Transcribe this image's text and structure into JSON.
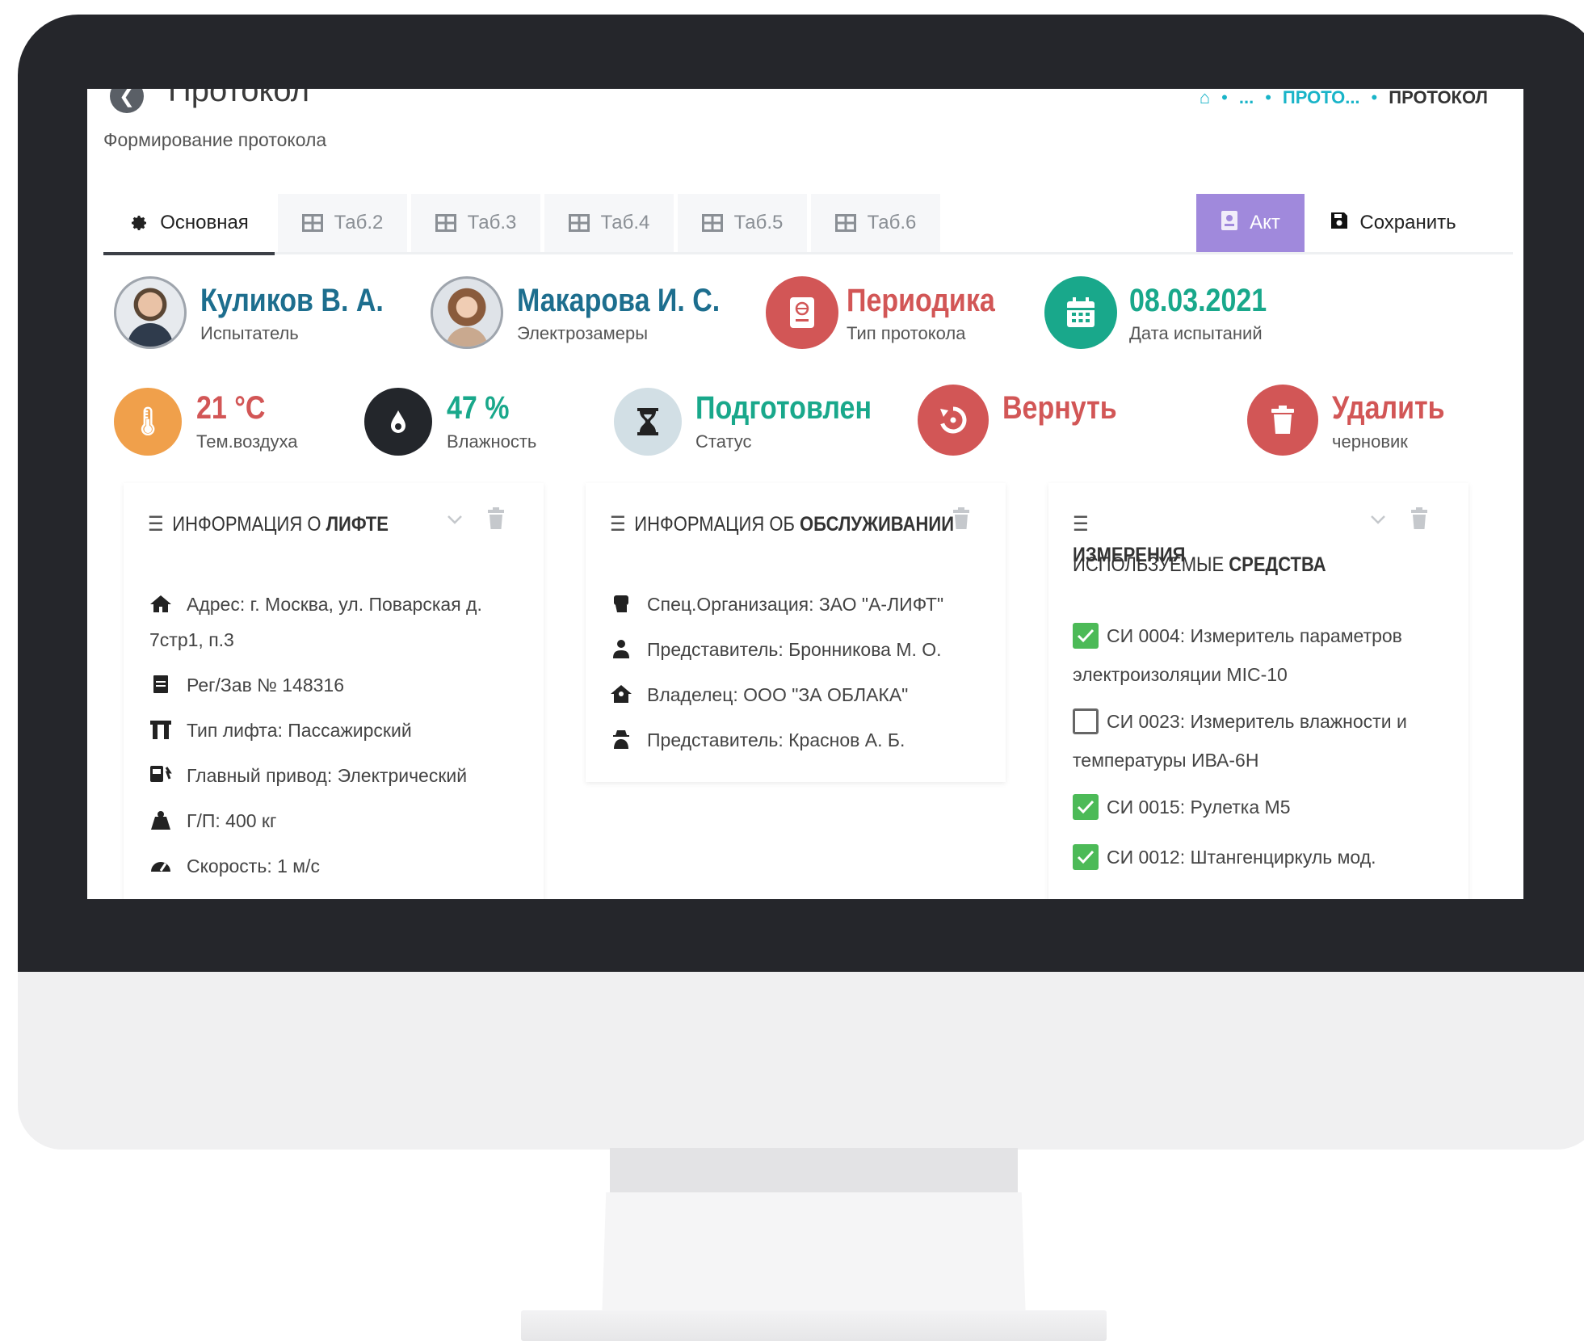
{
  "header": {
    "title": "Протокол",
    "subtitle": "Формирование протокола",
    "breadcrumb": {
      "ellipsis": "...",
      "parent": "ПРОТО...",
      "current": "ПРОТОКОЛ"
    }
  },
  "tabs": [
    {
      "label": "Основная",
      "icon": "gear-icon",
      "active": true
    },
    {
      "label": "Таб.2",
      "icon": "table-icon"
    },
    {
      "label": "Таб.3",
      "icon": "table-icon"
    },
    {
      "label": "Таб.4",
      "icon": "table-icon"
    },
    {
      "label": "Таб.5",
      "icon": "table-icon"
    },
    {
      "label": "Таб.6",
      "icon": "table-icon"
    }
  ],
  "actions": {
    "akt_label": "Акт",
    "save_label": "Сохранить"
  },
  "colors": {
    "blue": "#1d6e8e",
    "red": "#d25656",
    "green": "#19a88b",
    "orange": "#f0a04b",
    "purple": "#a089dc",
    "check": "#4cba57"
  },
  "stats": {
    "tester": {
      "value": "Куликов В. А.",
      "label": "Испытатель"
    },
    "engineer": {
      "value": "Макарова И. С.",
      "label": "Электрозамеры"
    },
    "protocol_type": {
      "value": "Периодика",
      "label": "Тип протокола"
    },
    "test_date": {
      "value": "08.03.2021",
      "label": "Дата испытаний"
    },
    "temperature": {
      "value": "21 °C",
      "label": "Тем.воздуха"
    },
    "humidity": {
      "value": "47 %",
      "label": "Влажность"
    },
    "status": {
      "value": "Подготовлен",
      "label": "Статус"
    },
    "return": {
      "value": "Вернуть"
    },
    "delete": {
      "value": "Удалить",
      "label": "черновик"
    }
  },
  "panels": {
    "lift": {
      "title_normal": "ИНФОРМАЦИЯ О",
      "title_bold": "ЛИФТЕ",
      "rows": [
        {
          "icon": "home-icon",
          "text": "Адрес: г. Москва, ул. Поварская д.",
          "text2": "7стр1, п.3"
        },
        {
          "icon": "document-icon",
          "text": "Рег/Зав № 148316"
        },
        {
          "icon": "gate-icon",
          "text": "Тип лифта: Пассажирский"
        },
        {
          "icon": "engine-icon",
          "text": "Главный привод: Электрический"
        },
        {
          "icon": "weight-icon",
          "text": "Г/П: 400 кг"
        },
        {
          "icon": "speedometer-icon",
          "text": "Скорость: 1 м/с"
        }
      ]
    },
    "service": {
      "title_normal": "ИНФОРМАЦИЯ ОБ",
      "title_bold": "ОБСЛУЖИВАНИИ",
      "rows": [
        {
          "icon": "fist-icon",
          "text": "Спец.Организация: ЗАО \"А-ЛИФТ\""
        },
        {
          "icon": "user-tie-icon",
          "text": "Представитель: Бронникова М. О."
        },
        {
          "icon": "house-user-icon",
          "text": "Владелец: ООО \"ЗА ОБЛАКА\""
        },
        {
          "icon": "user-secret-icon",
          "text": "Представитель: Краснов А. Б."
        }
      ]
    },
    "instruments": {
      "title_normal": "ИСПОЛЬЗУЕМЫЕ",
      "title_bold": "СРЕДСТВА",
      "title_bold2": "ИЗМЕРЕНИЯ",
      "items": [
        {
          "checked": true,
          "text": "СИ 0004: Измеритель параметров",
          "text2": "электроизоляции MIC-10"
        },
        {
          "checked": false,
          "text": "СИ 0023: Измеритель влажности и",
          "text2": "температуры ИВА-6Н"
        },
        {
          "checked": true,
          "text": "СИ 0015: Рулетка М5"
        },
        {
          "checked": true,
          "text": "СИ 0012: Штангенциркуль мод."
        }
      ]
    }
  }
}
